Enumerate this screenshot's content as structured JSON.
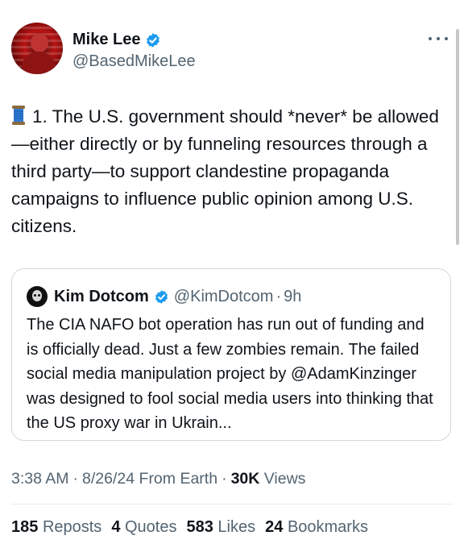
{
  "author": {
    "name": "Mike Lee",
    "handle": "@BasedMikeLee",
    "verified": true,
    "avatar_icon": "avatar-photo"
  },
  "more_icon": "more-horizontal-icon",
  "tweet": {
    "emoji": "spool-of-thread",
    "text": "1. The U.S. government should *never* be allowed—either directly or by funneling resources through a third party—to support clandestine propaganda campaigns to influence public opinion among U.S. citizens."
  },
  "quoted": {
    "name": "Kim Dotcom",
    "handle": "@KimDotcom",
    "separator": "·",
    "time": "9h",
    "verified": true,
    "text": "The CIA NAFO bot operation has run out of funding and is officially dead. Just a few zombies remain. The failed social media manipulation project by @AdamKinzinger was designed to fool social media users into thinking that the US proxy war in Ukrain..."
  },
  "meta": {
    "time": "3:38 AM",
    "date": "8/26/24",
    "source": "From Earth",
    "separator": "·",
    "views_count": "30K",
    "views_label": "Views"
  },
  "stats": {
    "reposts_count": "185",
    "reposts_label": "Reposts",
    "quotes_count": "4",
    "quotes_label": "Quotes",
    "likes_count": "583",
    "likes_label": "Likes",
    "bookmarks_count": "24",
    "bookmarks_label": "Bookmarks"
  },
  "colors": {
    "verified_blue": "#1d9bf0",
    "secondary_text": "#536471",
    "primary_text": "#0f1419",
    "border": "#cfd9de"
  }
}
